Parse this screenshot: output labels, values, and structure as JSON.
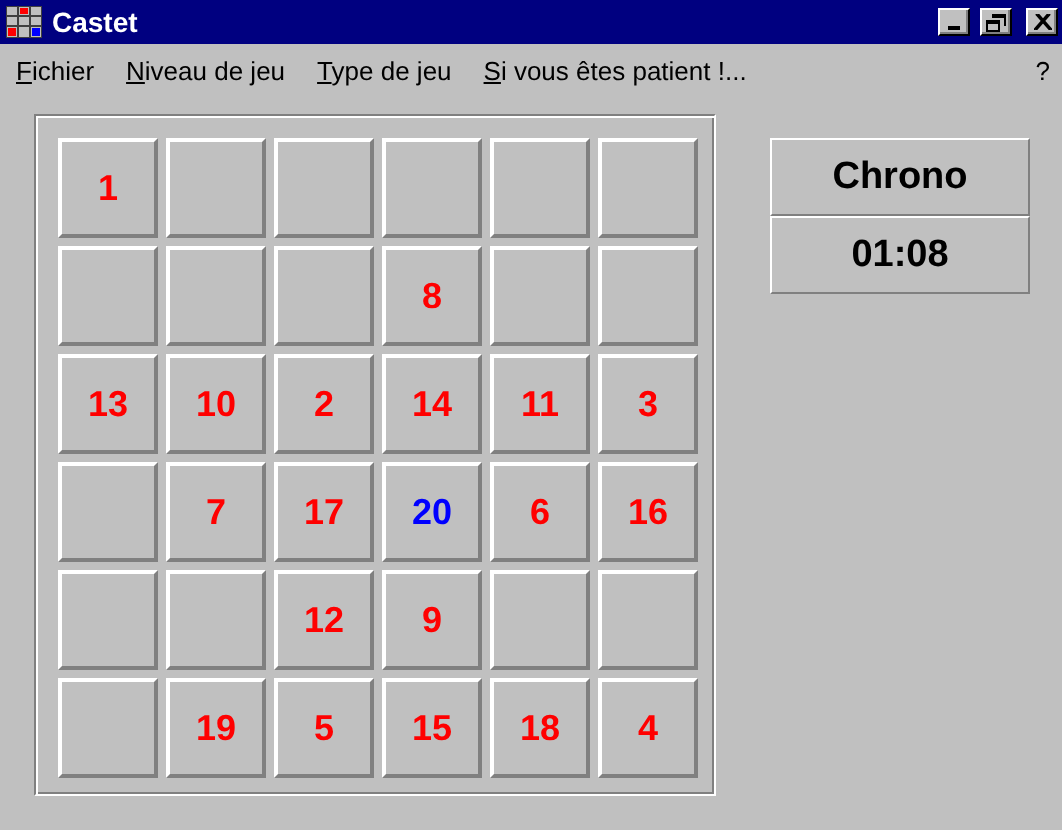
{
  "window": {
    "title": "Castet"
  },
  "menu": [
    {
      "label": "Fichier"
    },
    {
      "label": "Niveau de jeu"
    },
    {
      "label": "Type de jeu"
    },
    {
      "label": "Si vous êtes patient !..."
    }
  ],
  "help_menu": {
    "label": "?"
  },
  "board": {
    "rows": [
      [
        {
          "label": "1",
          "color": "#ff0000"
        },
        {},
        {},
        {},
        {},
        {}
      ],
      [
        {},
        {},
        {},
        {
          "label": "8",
          "color": "#ff0000"
        },
        {},
        {}
      ],
      [
        {
          "label": "13",
          "color": "#ff0000"
        },
        {
          "label": "10",
          "color": "#ff0000"
        },
        {
          "label": "2",
          "color": "#ff0000"
        },
        {
          "label": "14",
          "color": "#ff0000"
        },
        {
          "label": "11",
          "color": "#ff0000"
        },
        {
          "label": "3",
          "color": "#ff0000"
        }
      ],
      [
        {},
        {
          "label": "7",
          "color": "#ff0000"
        },
        {
          "label": "17",
          "color": "#ff0000"
        },
        {
          "label": "20",
          "color": "#0000ff"
        },
        {
          "label": "6",
          "color": "#ff0000"
        },
        {
          "label": "16",
          "color": "#ff0000"
        }
      ],
      [
        {},
        {},
        {
          "label": "12",
          "color": "#ff0000"
        },
        {
          "label": "9",
          "color": "#ff0000"
        },
        {},
        {}
      ],
      [
        {},
        {
          "label": "19",
          "color": "#ff0000"
        },
        {
          "label": "5",
          "color": "#ff0000"
        },
        {
          "label": "15",
          "color": "#ff0000"
        },
        {
          "label": "18",
          "color": "#ff0000"
        },
        {
          "label": "4",
          "color": "#ff0000"
        }
      ]
    ]
  },
  "chrono": {
    "title": "Chrono",
    "time": "01:08"
  }
}
